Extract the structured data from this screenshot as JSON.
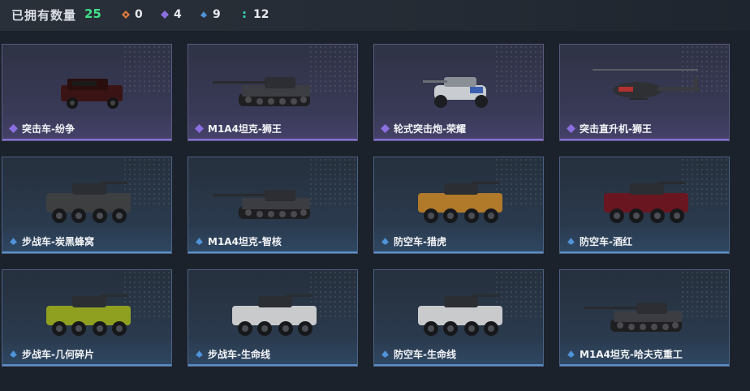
{
  "header": {
    "owned_label": "已拥有数量",
    "owned_count": "25",
    "stats": [
      {
        "icon": "orange-diamond-icon",
        "color": "#e07a3a",
        "value": "0"
      },
      {
        "icon": "purple-rhombus-icon",
        "color": "#8b6fe0",
        "value": "4"
      },
      {
        "icon": "blue-rhombus-icon",
        "color": "#4f93d8",
        "value": "9"
      },
      {
        "icon": "teal-dots-icon",
        "color": "#38c9b0",
        "value": "12"
      }
    ]
  },
  "cards": [
    {
      "name": "突击车-纷争",
      "rarity": "purple",
      "vehicle": "armored-suv"
    },
    {
      "name": "M1A4坦克-狮王",
      "rarity": "purple",
      "vehicle": "tank"
    },
    {
      "name": "轮式突击炮-荣耀",
      "rarity": "purple",
      "vehicle": "buggy"
    },
    {
      "name": "突击直升机-狮王",
      "rarity": "purple",
      "vehicle": "helicopter"
    },
    {
      "name": "步战车-炭黑蜂窝",
      "rarity": "blue",
      "vehicle": "ifv"
    },
    {
      "name": "M1A4坦克-智核",
      "rarity": "blue",
      "vehicle": "tank"
    },
    {
      "name": "防空车-猎虎",
      "rarity": "blue",
      "vehicle": "ifv"
    },
    {
      "name": "防空车-酒红",
      "rarity": "blue",
      "vehicle": "ifv"
    },
    {
      "name": "步战车-几何碎片",
      "rarity": "blue",
      "vehicle": "ifv"
    },
    {
      "name": "步战车-生命线",
      "rarity": "blue",
      "vehicle": "ifv"
    },
    {
      "name": "防空车-生命线",
      "rarity": "blue",
      "vehicle": "ifv"
    },
    {
      "name": "M1A4坦克-哈夫克重工",
      "rarity": "blue",
      "vehicle": "tank"
    }
  ],
  "colors": {
    "purple_accent": "#8a6fd6",
    "blue_accent": "#5d8fc9",
    "count_green": "#3fe08a"
  }
}
